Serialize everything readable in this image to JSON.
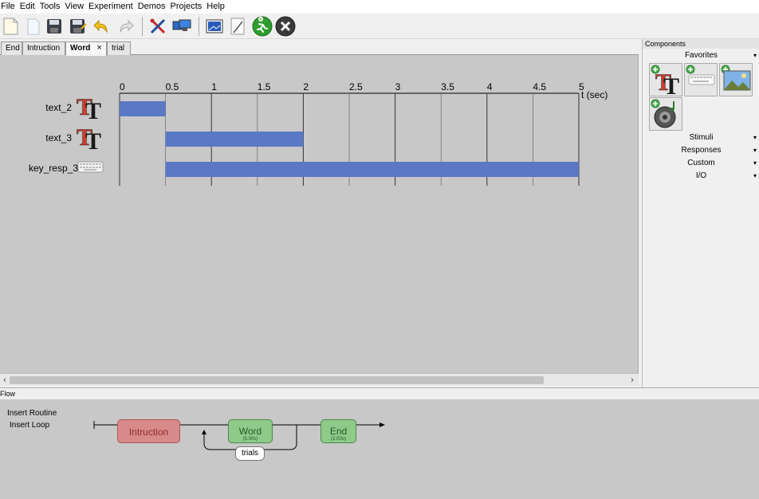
{
  "menu": [
    "File",
    "Edit",
    "Tools",
    "View",
    "Experiment",
    "Demos",
    "Projects",
    "Help"
  ],
  "toolbar": {
    "buttons": [
      "new-file-icon",
      "open-file-icon",
      "save-icon",
      "save-as-icon",
      "undo-icon",
      "redo-icon",
      "preferences-icon",
      "monitor-center-icon",
      "experiment-settings-icon",
      "compile-script-icon",
      "run-icon",
      "stop-icon"
    ]
  },
  "tabs": [
    {
      "label": "End",
      "active": false
    },
    {
      "label": "Intruction",
      "active": false
    },
    {
      "label": "Word",
      "active": true,
      "close": "×"
    },
    {
      "label": "trial",
      "active": false
    }
  ],
  "timeline": {
    "axis_label": "t (sec)",
    "ticks": [
      "0",
      "0.5",
      "1",
      "1.5",
      "2",
      "2.5",
      "3",
      "3.5",
      "4",
      "4.5",
      "5"
    ],
    "tmin": 0,
    "tmax": 5,
    "bar_color": "#5b78c5",
    "components": [
      {
        "name": "text_2",
        "icon": "text-component-icon",
        "start": 0,
        "stop": 0.5
      },
      {
        "name": "text_3",
        "icon": "text-component-icon",
        "start": 0.5,
        "stop": 2
      },
      {
        "name": "key_resp_3",
        "icon": "keyboard-component-icon",
        "start": 0.5,
        "stop": 5
      }
    ]
  },
  "components_panel": {
    "title": "Components",
    "favorites": "Favorites",
    "favorite_items": [
      "text-component-icon",
      "keyboard-component-icon",
      "image-component-icon",
      "sound-component-icon"
    ],
    "categories": [
      "Stimuli",
      "Responses",
      "Custom",
      "I/O"
    ],
    "caret": "▾"
  },
  "flow": {
    "title": "Flow",
    "insert_routine": "Insert Routine",
    "insert_loop": "Insert Loop",
    "routines": [
      {
        "label": "Intruction",
        "sub": "",
        "color": "#d8898a"
      },
      {
        "label": "Word",
        "sub": "(5.00s)",
        "color": "#8fca8a"
      },
      {
        "label": "End",
        "sub": "(2.00s)",
        "color": "#8fca8a"
      }
    ],
    "loop": "trials"
  }
}
